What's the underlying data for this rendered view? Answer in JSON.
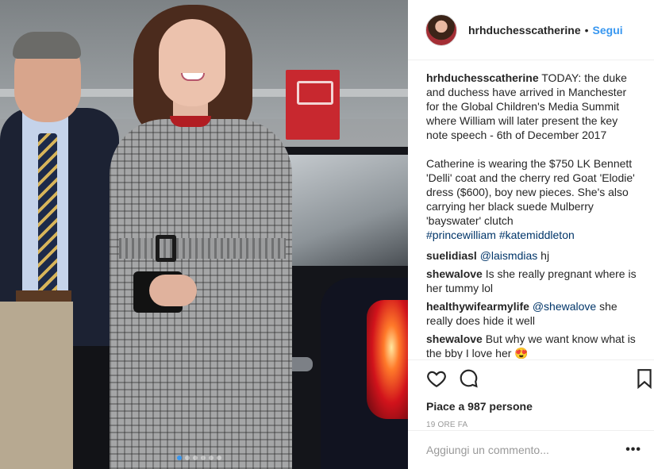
{
  "post": {
    "author": "hrhduchesscatherine",
    "separator": "•",
    "follow_label": "Segui"
  },
  "caption": {
    "username": "hrhduchesscatherine",
    "paragraph1": "TODAY: the duke and duchess have arrived in Manchester for the Global Children's Media Summit where William will later present the key note speech - 6th of December 2017",
    "paragraph2": "Catherine is wearing the $750 LK Bennett 'Delli' coat and the cherry red Goat 'Elodie' dress ($600), boy new pieces. She's also carrying her black suede Mulberry 'bayswater' clutch",
    "hashtags": [
      "#princewilliam",
      "#katemiddleton"
    ]
  },
  "comments": [
    {
      "username": "suelidiasl",
      "mention": "@laismdias",
      "text": "hj"
    },
    {
      "username": "shewalove",
      "mention": "",
      "text": "Is she really pregnant where is her tummy lol"
    },
    {
      "username": "healthywifearmylife",
      "mention": "@shewalove",
      "text": "she really does hide it well"
    },
    {
      "username": "shewalove",
      "mention": "",
      "text": "But why we want know what is the bby I love her 😍"
    }
  ],
  "actions": {
    "likes_text": "Piace a 987 persone",
    "time_ago": "19 ORE FA",
    "icons": [
      "heart-icon",
      "comment-icon",
      "bookmark-icon"
    ]
  },
  "add_comment": {
    "placeholder": "Aggiungi un commento...",
    "more_label": "•••"
  },
  "carousel": {
    "total": 6,
    "active_index": 0,
    "active_color": "#3897f0"
  },
  "colors": {
    "link": "#3897f0",
    "hashtag": "#003569",
    "text": "#262626",
    "muted": "#999999",
    "border": "#efefef"
  }
}
